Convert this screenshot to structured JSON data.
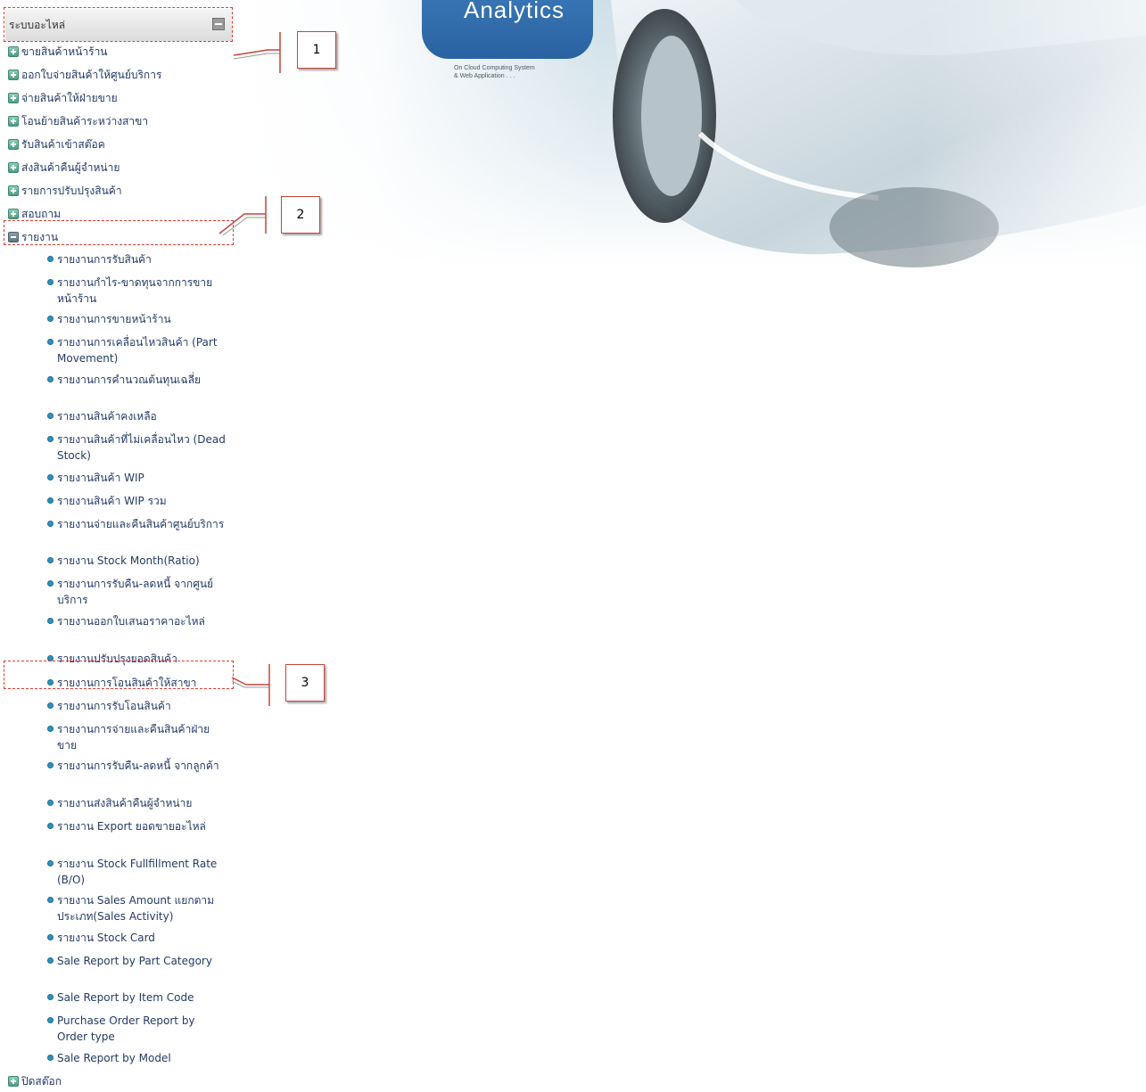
{
  "sidebar": {
    "root_label": "ระบบอะไหล่",
    "menu": [
      {
        "label": "ขายสินค้าหน้าร้าน"
      },
      {
        "label": "ออกใบจ่ายสินค้าให้ศูนย์บริการ"
      },
      {
        "label": "จ่ายสินค้าให้ฝ่ายขาย"
      },
      {
        "label": "โอนย้ายสินค้าระหว่างสาขา"
      },
      {
        "label": "รับสินค้าเข้าสต๊อค"
      },
      {
        "label": "ส่งสินค้าคืนผู้จำหน่าย"
      },
      {
        "label": "รายการปรับปรุงสินค้า"
      },
      {
        "label": "สอบถาม"
      },
      {
        "label": "รายงาน"
      }
    ],
    "reports": [
      {
        "label": "รายงานการรับสินค้า"
      },
      {
        "label": "รายงานกำไร-ขาดทุนจากการขายหน้าร้าน"
      },
      {
        "label": "รายงานการขายหน้าร้าน"
      },
      {
        "label": "รายงานการเคลื่อนไหวสินค้า (Part Movement)"
      },
      {
        "label": "รายงานการคำนวณต้นทุนเฉลี่ย"
      },
      {
        "label": "รายงานสินค้าคงเหลือ"
      },
      {
        "label": "รายงานสินค้าที่ไม่เคลื่อนไหว (Dead Stock)"
      },
      {
        "label": "รายงานสินค้า WIP"
      },
      {
        "label": "รายงานสินค้า WIP รวม"
      },
      {
        "label": "รายงานจ่ายและคืนสินค้าศูนย์บริการ"
      },
      {
        "label": "รายงาน Stock Month(Ratio)"
      },
      {
        "label": "รายงานการรับคืน-ลดหนี้ จากศูนย์บริการ"
      },
      {
        "label": "รายงานออกใบเสนอราคาอะไหล่"
      },
      {
        "label": "รายงานปรับปรุงยอดสินค้า"
      },
      {
        "label": "รายงานการโอนสินค้าให้สาขา"
      },
      {
        "label": "รายงานการรับโอนสินค้า"
      },
      {
        "label": "รายงานการจ่ายและคืนสินค้าฝ่ายขาย"
      },
      {
        "label": "รายงานการรับคืน-ลดหนี้ จากลูกค้า"
      },
      {
        "label": "รายงานส่งสินค้าคืนผู้จำหน่าย"
      },
      {
        "label": "รายงาน Export ยอดขายอะไหล่"
      },
      {
        "label": "รายงาน Stock Fullfillment Rate (B/O)"
      },
      {
        "label": "รายงาน Sales Amount แยกตามประเภท(Sales Activity)"
      },
      {
        "label": "รายงาน Stock Card"
      },
      {
        "label": "Sale Report by Part Category"
      },
      {
        "label": "Sale Report by Item Code"
      },
      {
        "label": "Purchase Order Report by Order type"
      },
      {
        "label": "Sale Report by Model"
      }
    ],
    "bottom_item": {
      "label": "ปิดสต๊อก"
    }
  },
  "callouts": [
    {
      "number": "1"
    },
    {
      "number": "2"
    },
    {
      "number": "3"
    }
  ],
  "banner": {
    "logo_text": "Analytics",
    "tagline_line1": "On Cloud Computing System",
    "tagline_line2": "& Web Application . . ."
  },
  "colors": {
    "annotation_red": "#e23b2e",
    "menu_text": "#243a67",
    "bullet_blue": "#2e92bd",
    "logo_blue": "#2a62a1"
  }
}
